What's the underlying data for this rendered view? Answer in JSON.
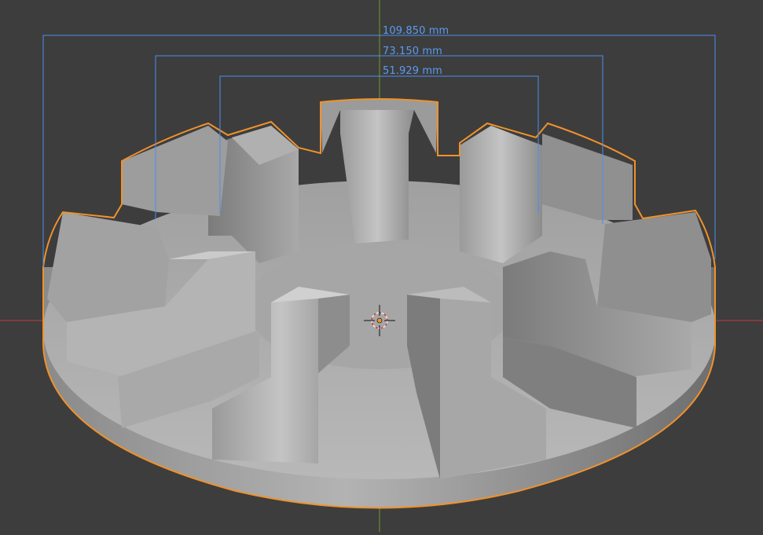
{
  "viewport": {
    "background_color": "#3d3d3d",
    "selection_outline_color": "#f0922b",
    "measure_color": "#4a8ff0",
    "x_axis_color": "#c23a3a",
    "y_axis_color": "#6d9a2c",
    "object_color": "#a7a7a7"
  },
  "measurements": [
    {
      "label": "109.850 mm"
    },
    {
      "label": "73.150 mm"
    },
    {
      "label": "51.929 mm"
    }
  ],
  "icons": {
    "cursor": "3d-cursor-icon",
    "origin": "object-origin-icon"
  }
}
